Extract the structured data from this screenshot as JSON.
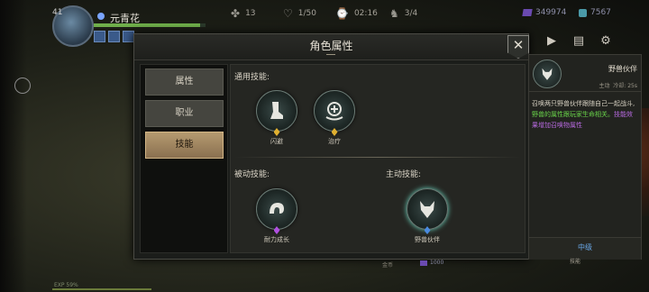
{
  "hud": {
    "level": "41",
    "player_name": "元青花",
    "hp_fraction": 0.95,
    "stats": [
      {
        "icon": "paw-icon",
        "value": "13"
      },
      {
        "icon": "heart-icon",
        "value": "1/50"
      },
      {
        "icon": "timer-icon",
        "value": "02:16"
      },
      {
        "icon": "wolf-icon",
        "value": "3/4"
      }
    ],
    "currency_gem": "349974",
    "currency_crystal": "7567",
    "bottom_left": "EXP 59%",
    "bottom_mid": "金币",
    "bottom_res": "1000"
  },
  "dialog": {
    "title": "角色属性",
    "close_glyph": "✕",
    "tabs": [
      {
        "label": "属性",
        "active": false
      },
      {
        "label": "职业",
        "active": false
      },
      {
        "label": "技能",
        "active": true
      }
    ],
    "general_label": "通用技能:",
    "passive_label": "被动技能:",
    "active_label": "主动技能:",
    "skills": {
      "dodge": {
        "name": "闪避",
        "gem": "#e0b030"
      },
      "heal": {
        "name": "治疗",
        "gem": "#e0b030"
      },
      "endurance": {
        "name": "耐力成长",
        "gem": "#b050e0"
      },
      "beast": {
        "name": "野兽伙伴",
        "gem": "#4a8ae0"
      }
    }
  },
  "detail": {
    "name": "野兽伙伴",
    "type": "主动",
    "cooldown": "冷却: 25s",
    "desc_1": "召唤两只野兽伙伴跟随自己一起战斗,",
    "desc_2": "野兽的属性跟玩家生命相关。",
    "desc_3": "技能效果增加召唤物属性",
    "level": "中级",
    "sub": "技能"
  },
  "colors": {
    "accent_gold": "#b59a70",
    "green_text": "#6ad64a",
    "purple_text": "#b86ae0",
    "level_blue": "#6aa8e8"
  }
}
